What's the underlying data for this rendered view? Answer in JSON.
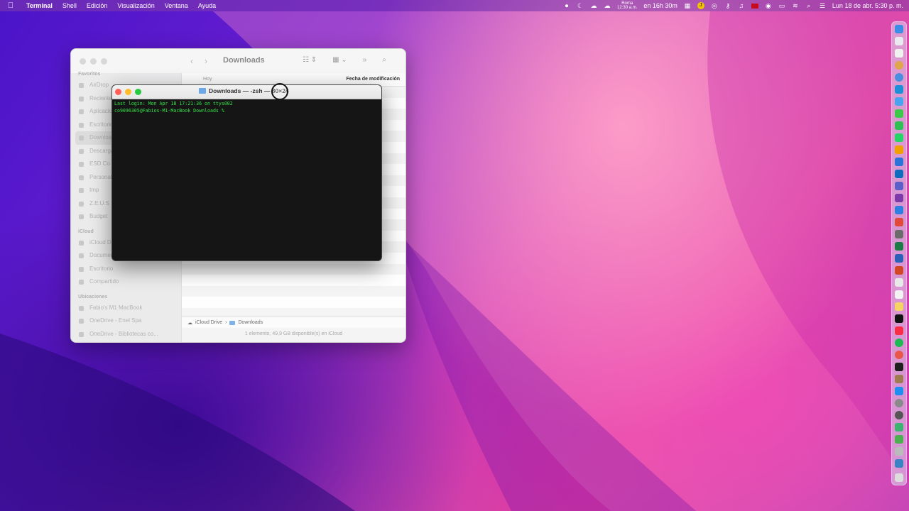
{
  "menubar": {
    "app_name": "Terminal",
    "menus": [
      "Shell",
      "Edición",
      "Visualización",
      "Ventana",
      "Ayuda"
    ],
    "clock_city": "Roma",
    "clock_city_time": "12:30 a.m.",
    "timer": "en 16h 30m",
    "datetime": "Lun 18 de abr.  5:30 p. m."
  },
  "finder": {
    "title": "Downloads",
    "sidebar": {
      "favorites_header": "Favoritos",
      "favorites": [
        "AirDrop",
        "Recientes",
        "Aplicaciones",
        "Escritorio",
        "Downloads",
        "Descargas",
        "ESD Co",
        "Personal",
        "tmp",
        "Z.E.U.S",
        "Budget"
      ],
      "icloud_header": "iCloud",
      "icloud": [
        "iCloud Drive",
        "Documentos",
        "Escritorio",
        "Compartido"
      ],
      "locations_header": "Ubicaciones",
      "locations": [
        "Fabio's M1 MacBook",
        "OneDrive - Enel Spa",
        "OneDrive - Bibliotecas co..."
      ]
    },
    "columns": {
      "group": "Hoy",
      "modified": "Fecha de modificación"
    },
    "path": {
      "root": "iCloud Drive",
      "separator": "›",
      "current": "Downloads"
    },
    "status": "1 elemento, 49,9 GB disponible(s) en iCloud"
  },
  "terminal": {
    "title": "Downloads — -zsh — 80×24",
    "lines": [
      "Last login: Mon Apr 18 17:21:36 on ttys002",
      "co9096305@Fabios-M1-MacBook Downloads % "
    ]
  },
  "colors": {
    "close": "#ff5f57",
    "minimize": "#febc2e",
    "zoom": "#28c840",
    "terminal_text": "#37e34a"
  }
}
